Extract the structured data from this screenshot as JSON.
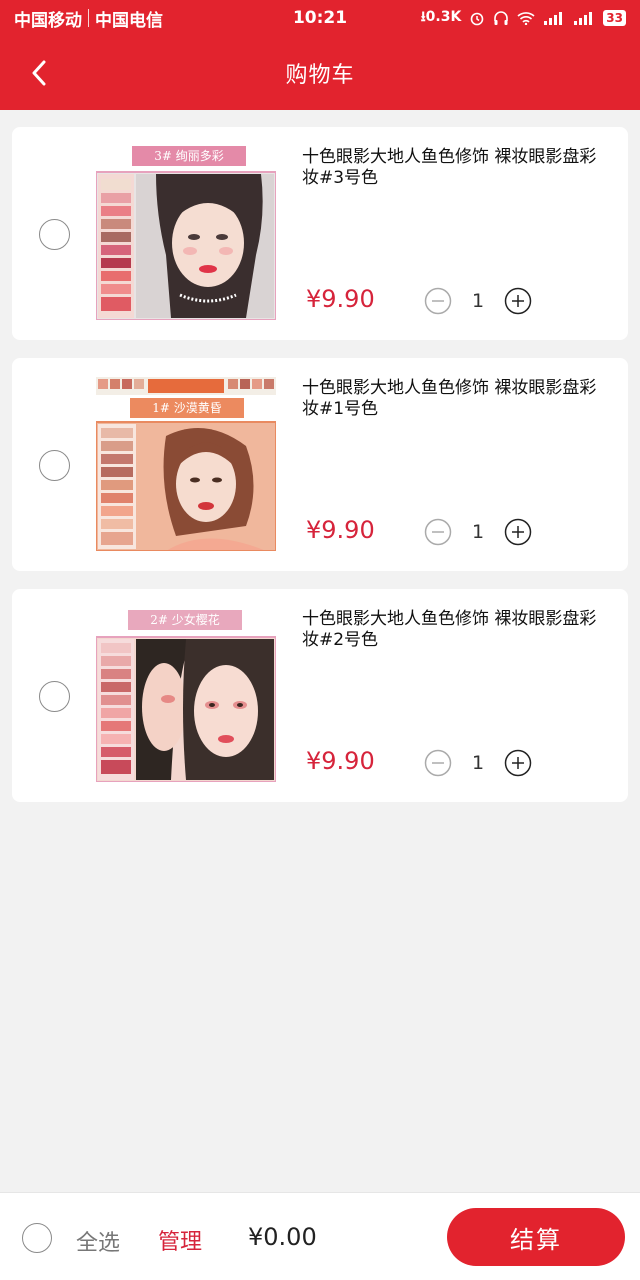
{
  "status_bar": {
    "carrier_1": "中国移动",
    "carrier_2": "中国电信",
    "time": "10:21",
    "net_speed": "0.3K",
    "battery": "33"
  },
  "header": {
    "title": "购物车",
    "back_icon": "chevron-left-icon"
  },
  "colors": {
    "brand_red": "#e2232e",
    "price_red": "#d6243b",
    "background": "#f2f2f2"
  },
  "cart": {
    "items": [
      {
        "title": "十色眼影大地人鱼色修饰 裸妆眼影盘彩妆#3号色",
        "banner": "3# 绚丽多彩",
        "price": "¥9.90",
        "quantity": "1"
      },
      {
        "title": "十色眼影大地人鱼色修饰 裸妆眼影盘彩妆#1号色",
        "banner": "1# 沙漠黄昏",
        "price": "¥9.90",
        "quantity": "1"
      },
      {
        "title": "十色眼影大地人鱼色修饰 裸妆眼影盘彩妆#2号色",
        "banner": "2# 少女樱花",
        "price": "¥9.90",
        "quantity": "1"
      }
    ]
  },
  "footer": {
    "select_all": "全选",
    "manage": "管理",
    "total": "¥0.00",
    "checkout": "结算"
  }
}
